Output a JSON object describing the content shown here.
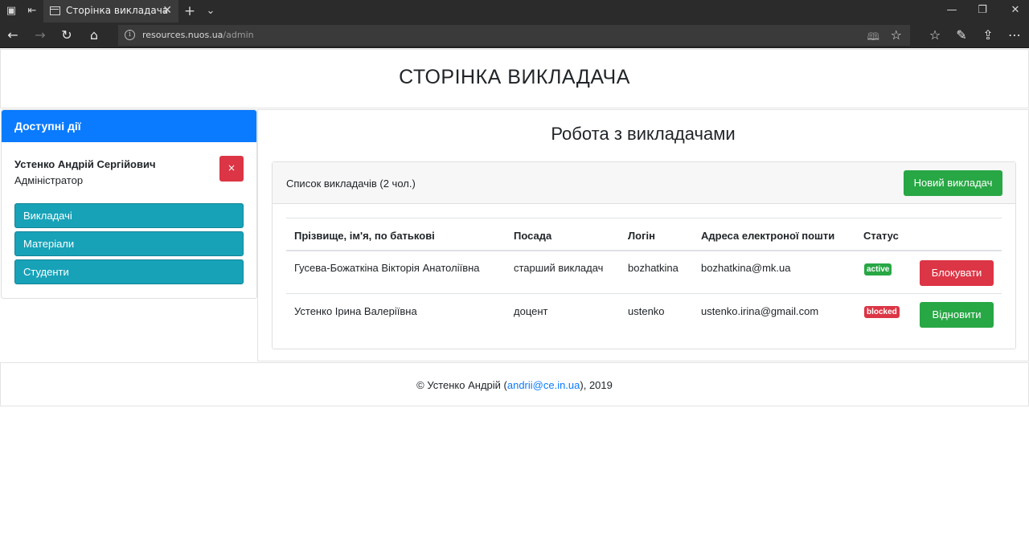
{
  "browser": {
    "tab_title": "Сторінка викладача",
    "url_host": "resources.nuos.ua",
    "url_path": "/admin"
  },
  "header": {
    "title": "СТОРІНКА ВИКЛАДАЧА"
  },
  "sidebar": {
    "heading": "Доступні дії",
    "user_name": "Устенко Андрій Сергійович",
    "user_role": "Адміністратор",
    "logout_label": "×",
    "items": [
      {
        "label": "Викладачі"
      },
      {
        "label": "Матеріали"
      },
      {
        "label": "Студенти"
      }
    ]
  },
  "main": {
    "title": "Робота з викладачами",
    "list_caption": "Список викладачів (2 чол.)",
    "new_button": "Новий викладач",
    "columns": [
      "Прізвище, ім'я, по батькові",
      "Посада",
      "Логін",
      "Адреса електроної пошти",
      "Статус"
    ],
    "rows": [
      {
        "name": "Гусева-Божаткіна Вікторія Анатоліївна",
        "position": "старший викладач",
        "login": "bozhatkina",
        "email": "bozhatkina@mk.ua",
        "status": "active",
        "action": "Блокувати"
      },
      {
        "name": "Устенко Ірина Валеріївна",
        "position": "доцент",
        "login": "ustenko",
        "email": "ustenko.irina@gmail.com",
        "status": "blocked",
        "action": "Відновити"
      }
    ]
  },
  "footer": {
    "prefix": "© Устенко Андрій (",
    "email": "andrii@ce.in.ua",
    "suffix": "), 2019"
  },
  "colors": {
    "primary": "#0a7bff",
    "info": "#17a2b8",
    "success": "#28a745",
    "danger": "#dc3545"
  }
}
